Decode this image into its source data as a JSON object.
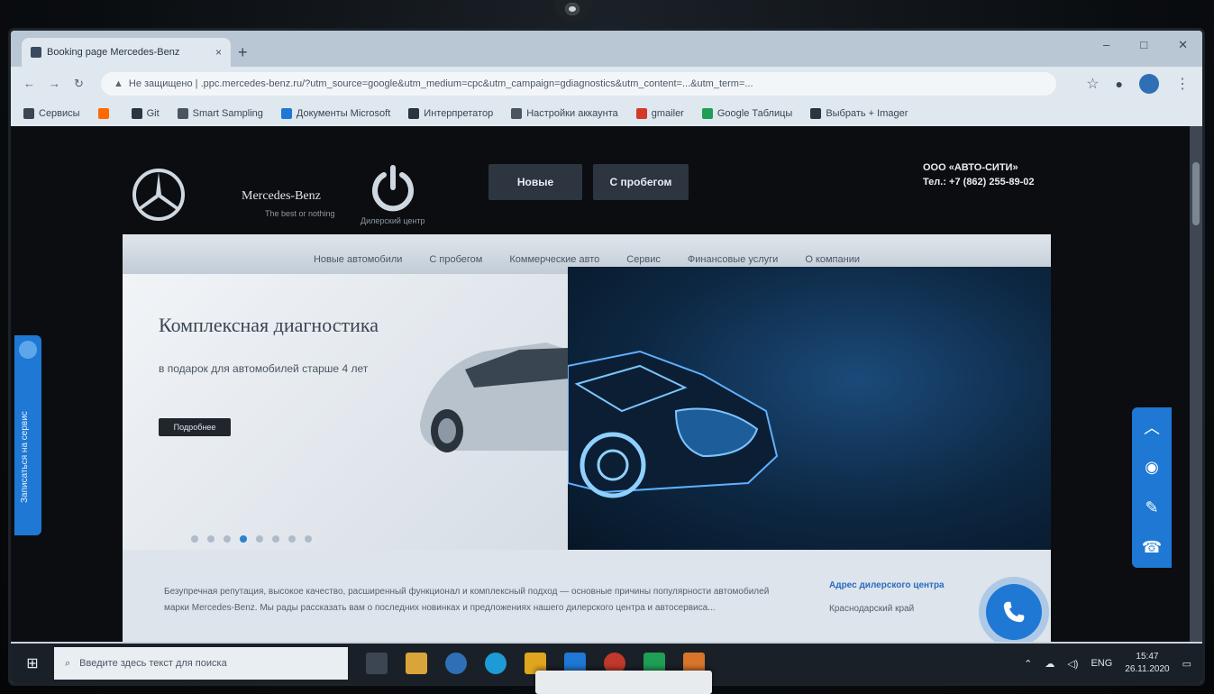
{
  "browser": {
    "tab_title": "Booking page Mercedes-Benz",
    "tab_close": "×",
    "new_tab": "+",
    "window_controls": [
      "–",
      "□",
      "✕"
    ],
    "url": "Не защищено | .ppc.mercedes-benz.ru/?utm_source=google&utm_medium=cpc&utm_campaign=gdiagnostics&utm_content=...&utm_term=...",
    "bookmarks": [
      {
        "label": "Сервисы",
        "color": "#3b4652"
      },
      {
        "label": "",
        "color": "#ff6a00"
      },
      {
        "label": "Git",
        "color": "#2b3540"
      },
      {
        "label": "Smart Sampling",
        "color": "#4a5560"
      },
      {
        "label": "Документы Microsoft",
        "color": "#1e78d4"
      },
      {
        "label": "Интерпретатор",
        "color": "#2b3540"
      },
      {
        "label": "Настройки аккаунта",
        "color": "#4a5560"
      },
      {
        "label": "gmailer",
        "color": "#d43a2a"
      },
      {
        "label": "Google Таблицы",
        "color": "#1f9e55"
      },
      {
        "label": "Выбрать + Imager",
        "color": "#2b3540"
      }
    ]
  },
  "header": {
    "brand_name": "Mercedes-Benz",
    "brand_tagline": "The best or nothing",
    "dealer_tagline": "Дилерский центр",
    "buttons": [
      "Новые",
      "С пробегом"
    ],
    "contact_line1": "ООО «АВТО-СИТИ»",
    "contact_line2": "Тел.: +7 (862) 255-89-02"
  },
  "hero": {
    "nav": [
      "Новые автомобили",
      "С пробегом",
      "Коммерческие авто",
      "Сервис",
      "Финансовые услуги",
      "О компании"
    ],
    "slide_title": "Комплексная диагностика",
    "slide_subtitle": "в подарок для автомобилей старше 4 лет",
    "slide_button": "Подробнее",
    "dots_total": 8,
    "active_dot": 4
  },
  "info": {
    "body_text": "Безупречная репутация, высокое качество, расширенный функционал и комплексный подход — основные причины популярности автомобилей марки Mercedes-Benz. Мы рады рассказать вам о последних новинках и предложениях нашего дилерского центра и автосервиса...",
    "side_title": "Адрес дилерского центра",
    "side_text": "Краснодарский край"
  },
  "widgets": {
    "left_tab_label": "Записаться на сервис",
    "right_widget_icons": [
      "chevron-up-icon",
      "car-icon",
      "wrench-icon",
      "phone-icon"
    ]
  },
  "taskbar": {
    "search_placeholder": "Введите здесь текст для поиска",
    "lang": "ENG",
    "time": "15:47",
    "date": "26.11.2020"
  }
}
